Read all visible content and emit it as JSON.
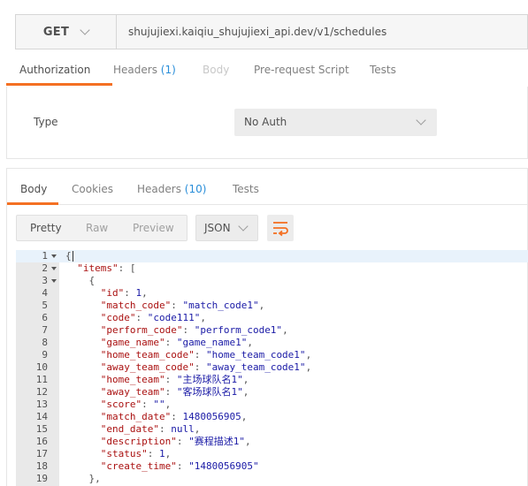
{
  "request": {
    "method": "GET",
    "url": "shujujiexi.kaiqiu_shujujiexi_api.dev/v1/schedules"
  },
  "request_tabs": [
    {
      "label": "Authorization",
      "count": "",
      "active": true,
      "disabled": false
    },
    {
      "label": "Headers",
      "count": "(1)",
      "active": false,
      "disabled": false
    },
    {
      "label": "Body",
      "count": "",
      "active": false,
      "disabled": true
    },
    {
      "label": "Pre-request Script",
      "count": "",
      "active": false,
      "disabled": false
    },
    {
      "label": "Tests",
      "count": "",
      "active": false,
      "disabled": false
    }
  ],
  "auth": {
    "type_label": "Type",
    "type_value": "No Auth"
  },
  "response_tabs": [
    {
      "label": "Body",
      "count": "",
      "active": true
    },
    {
      "label": "Cookies",
      "count": "",
      "active": false
    },
    {
      "label": "Headers",
      "count": "(10)",
      "active": false
    },
    {
      "label": "Tests",
      "count": "",
      "active": false
    }
  ],
  "view_modes": [
    "Pretty",
    "Raw",
    "Preview"
  ],
  "active_view": "Pretty",
  "format": "JSON",
  "icons": {
    "method_dropdown": "chevron-down-icon",
    "auth_dropdown": "chevron-down-icon",
    "format_dropdown": "chevron-down-icon",
    "wrap": "wrap-lines-icon"
  },
  "colors": {
    "accent": "#f47023",
    "count": "#2a8ed9",
    "key": "#aa1111",
    "value": "#1a1aa6"
  },
  "code_lines": [
    {
      "num": "1",
      "fold": true,
      "text": "{"
    },
    {
      "num": "2",
      "fold": true,
      "text": "  \"items\": ["
    },
    {
      "num": "3",
      "fold": true,
      "text": "    {"
    },
    {
      "num": "4",
      "fold": false,
      "text": "      \"id\": 1,"
    },
    {
      "num": "5",
      "fold": false,
      "text": "      \"match_code\": \"match_code1\","
    },
    {
      "num": "6",
      "fold": false,
      "text": "      \"code\": \"code111\","
    },
    {
      "num": "7",
      "fold": false,
      "text": "      \"perform_code\": \"perform_code1\","
    },
    {
      "num": "8",
      "fold": false,
      "text": "      \"game_name\": \"game_name1\","
    },
    {
      "num": "9",
      "fold": false,
      "text": "      \"home_team_code\": \"home_team_code1\","
    },
    {
      "num": "10",
      "fold": false,
      "text": "      \"away_team_code\": \"away_team_code1\","
    },
    {
      "num": "11",
      "fold": false,
      "text": "      \"home_team\": \"主场球队名1\","
    },
    {
      "num": "12",
      "fold": false,
      "text": "      \"away_team\": \"客场球队名1\","
    },
    {
      "num": "13",
      "fold": false,
      "text": "      \"score\": \"\","
    },
    {
      "num": "14",
      "fold": false,
      "text": "      \"match_date\": 1480056905,"
    },
    {
      "num": "15",
      "fold": false,
      "text": "      \"end_date\": null,"
    },
    {
      "num": "16",
      "fold": false,
      "text": "      \"description\": \"赛程描述1\","
    },
    {
      "num": "17",
      "fold": false,
      "text": "      \"status\": 1,"
    },
    {
      "num": "18",
      "fold": false,
      "text": "      \"create_time\": \"1480056905\""
    },
    {
      "num": "19",
      "fold": false,
      "text": "    },"
    }
  ]
}
